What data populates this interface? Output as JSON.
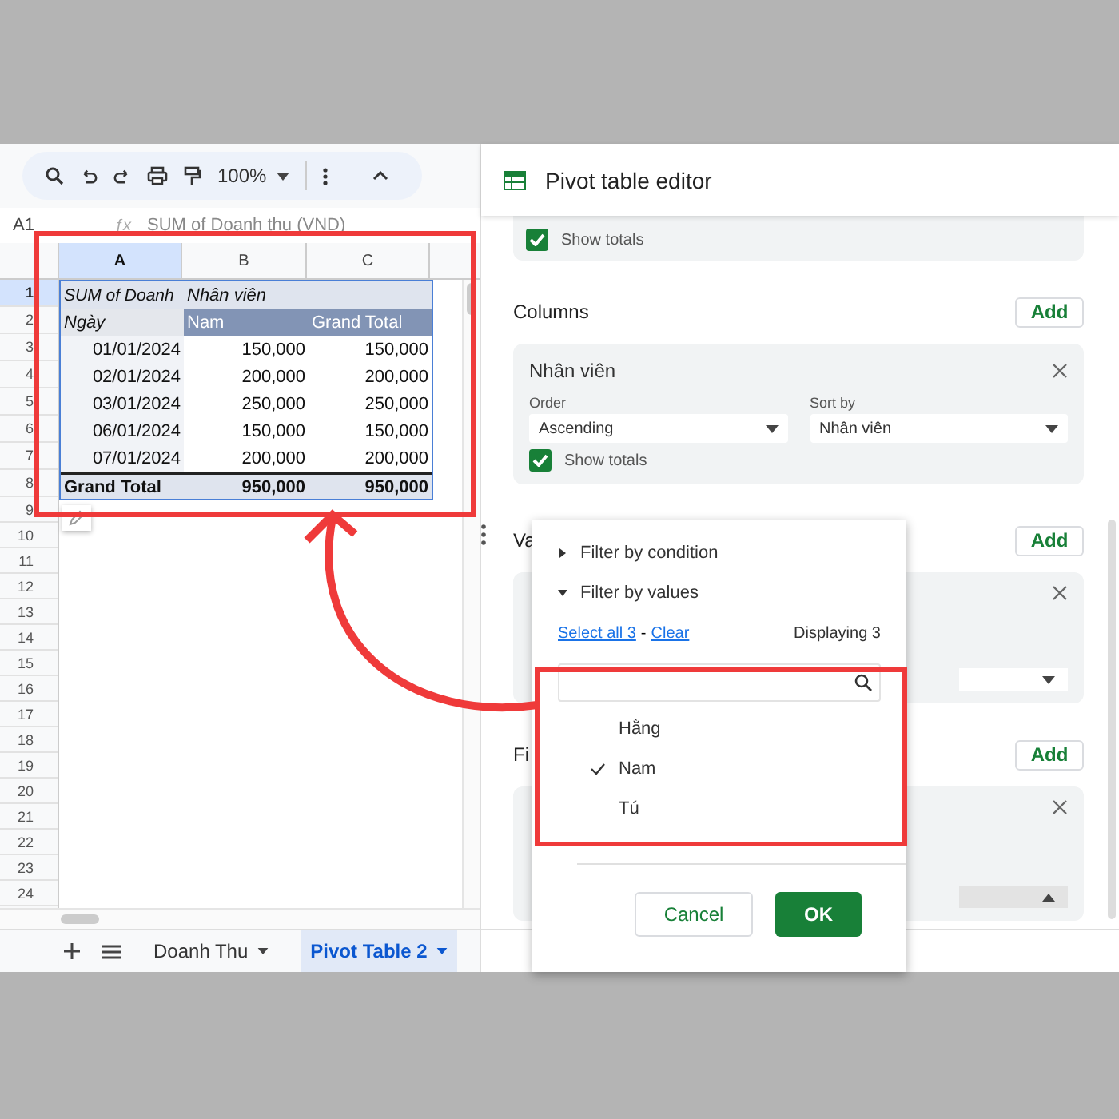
{
  "toolbar": {
    "zoom": "100%"
  },
  "name_box": "A1",
  "formula_icon": "ƒx",
  "formula": "SUM of Doanh thu (VND)",
  "columns": [
    {
      "label": "A",
      "selected": true
    },
    {
      "label": "B",
      "selected": false
    },
    {
      "label": "C",
      "selected": false
    }
  ],
  "row_numbers": [
    {
      "label": "1",
      "selected": true
    },
    {
      "label": "2",
      "selected": false
    },
    {
      "label": "3",
      "selected": false
    },
    {
      "label": "4",
      "selected": false
    },
    {
      "label": "5",
      "selected": false
    },
    {
      "label": "6",
      "selected": false
    },
    {
      "label": "7",
      "selected": false
    },
    {
      "label": "8",
      "selected": false
    },
    {
      "label": "9",
      "selected": false
    },
    {
      "label": "10",
      "selected": false
    },
    {
      "label": "11",
      "selected": false
    },
    {
      "label": "12",
      "selected": false
    },
    {
      "label": "13",
      "selected": false
    },
    {
      "label": "14",
      "selected": false
    },
    {
      "label": "15",
      "selected": false
    },
    {
      "label": "16",
      "selected": false
    },
    {
      "label": "17",
      "selected": false
    },
    {
      "label": "18",
      "selected": false
    },
    {
      "label": "19",
      "selected": false
    },
    {
      "label": "20",
      "selected": false
    },
    {
      "label": "21",
      "selected": false
    },
    {
      "label": "22",
      "selected": false
    },
    {
      "label": "23",
      "selected": false
    },
    {
      "label": "24",
      "selected": false
    }
  ],
  "pivot": {
    "corner": "SUM of Doanh",
    "column_field": "Nhân viên",
    "row_header": "Ngày",
    "column_headers": [
      "Nam",
      "Grand Total"
    ],
    "rows": [
      {
        "date": "01/01/2024",
        "values": [
          "150,000",
          "150,000"
        ]
      },
      {
        "date": "02/01/2024",
        "values": [
          "200,000",
          "200,000"
        ]
      },
      {
        "date": "03/01/2024",
        "values": [
          "250,000",
          "250,000"
        ]
      },
      {
        "date": "06/01/2024",
        "values": [
          "150,000",
          "150,000"
        ]
      },
      {
        "date": "07/01/2024",
        "values": [
          "200,000",
          "200,000"
        ]
      }
    ],
    "total": {
      "label": "Grand Total",
      "values": [
        "950,000",
        "950,000"
      ]
    }
  },
  "sheet_tabs": [
    {
      "label": "Doanh Thu",
      "selected": false
    },
    {
      "label": "Pivot Table 2",
      "selected": true
    }
  ],
  "editor": {
    "title": "Pivot table editor",
    "rows_card_tail": {
      "show_totals": {
        "label": "Show totals",
        "checked": true
      }
    },
    "columns_section": {
      "title": "Columns",
      "add": "Add",
      "card": {
        "field": "Nhân viên",
        "order_label": "Order",
        "order": "Ascending",
        "sort_label": "Sort by",
        "sort": "Nhân viên",
        "show_totals": {
          "label": "Show totals",
          "checked": true
        }
      }
    },
    "values_section": {
      "title": "Va",
      "add": "Add"
    },
    "filters_section": {
      "title": "Fi",
      "add": "Add"
    }
  },
  "filter_popup": {
    "sections": [
      {
        "label": "Filter by condition",
        "expanded": false
      },
      {
        "label": "Filter by values",
        "expanded": true
      }
    ],
    "select_all": "Select all 3",
    "separator": "-",
    "clear": "Clear",
    "displaying": "Displaying 3",
    "items": [
      {
        "label": "Hằng",
        "checked": false
      },
      {
        "label": "Nam",
        "checked": true
      },
      {
        "label": "Tú",
        "checked": false
      }
    ],
    "cancel": "Cancel",
    "ok": "OK"
  }
}
